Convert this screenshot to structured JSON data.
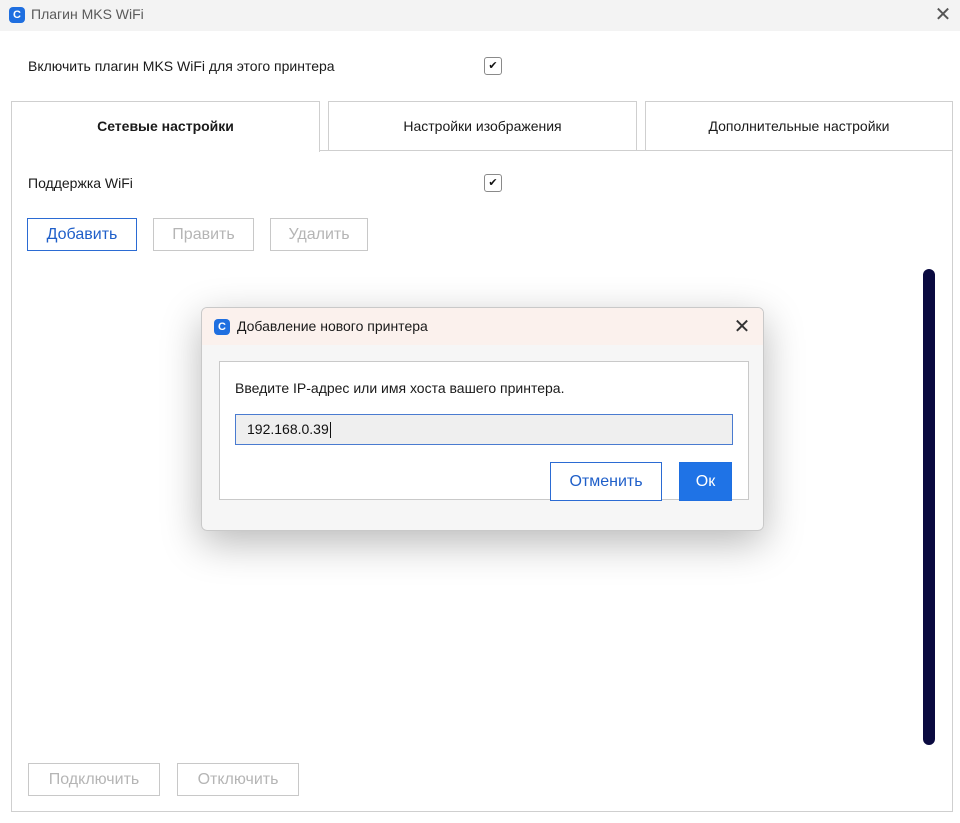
{
  "window": {
    "title": "Плагин MKS WiFi",
    "icon": "app-c-icon",
    "close_glyph": "✕"
  },
  "enable_plugin": {
    "label": "Включить плагин MKS WiFi для этого принтера",
    "checked": true
  },
  "tabs": [
    {
      "label": "Сетевые настройки",
      "active": true
    },
    {
      "label": "Настройки изображения",
      "active": false
    },
    {
      "label": "Дополнительные настройки",
      "active": false
    }
  ],
  "network": {
    "wifi_support": {
      "label": "Поддержка WiFi",
      "checked": true
    },
    "buttons": {
      "add": "Добавить",
      "edit": "Править",
      "delete": "Удалить"
    },
    "bottom_buttons": {
      "connect": "Подключить",
      "disconnect": "Отключить"
    }
  },
  "dialog": {
    "title": "Добавление нового принтера",
    "close_glyph": "✕",
    "prompt": "Введите IP-адрес или имя хоста вашего принтера.",
    "input_value": "192.168.0.39",
    "cancel_label": "Отменить",
    "ok_label": "Ок"
  },
  "colors": {
    "accent": "#1f73e6",
    "dialog_title_bg": "#fbf1ed",
    "scrollbar": "#0a0a40"
  }
}
